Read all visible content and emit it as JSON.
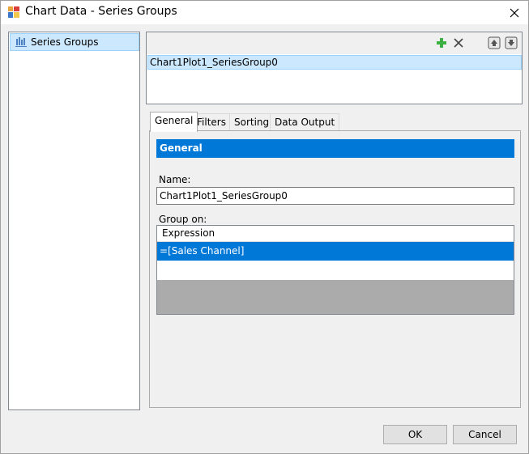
{
  "window": {
    "title": "Chart Data - Series Groups",
    "app_icon": "chart-app-icon",
    "close_icon": "close-icon"
  },
  "sidebar": {
    "items": [
      {
        "label": "Series Groups",
        "icon": "series-groups-icon",
        "selected": true
      }
    ]
  },
  "groups": {
    "toolbar": {
      "add_icon": "plus-icon",
      "delete_icon": "delete-x-icon",
      "move_up_icon": "arrow-up-icon",
      "move_down_icon": "arrow-down-icon"
    },
    "items": [
      "Chart1Plot1_SeriesGroup0"
    ]
  },
  "tabs": [
    {
      "label": "General",
      "active": true
    },
    {
      "label": "Filters",
      "active": false
    },
    {
      "label": "Sorting",
      "active": false
    },
    {
      "label": "Data Output",
      "active": false
    }
  ],
  "general": {
    "section_title": "General",
    "name_label": "Name:",
    "name_value": "Chart1Plot1_SeriesGroup0",
    "group_on_label": "Group on:",
    "grid": {
      "column_header": "Expression",
      "rows": [
        "=[Sales Channel]"
      ]
    }
  },
  "buttons": {
    "ok": "OK",
    "cancel": "Cancel"
  },
  "colors": {
    "accent": "#0078d7",
    "selection": "#cce8ff",
    "add_green": "#3cb043"
  }
}
